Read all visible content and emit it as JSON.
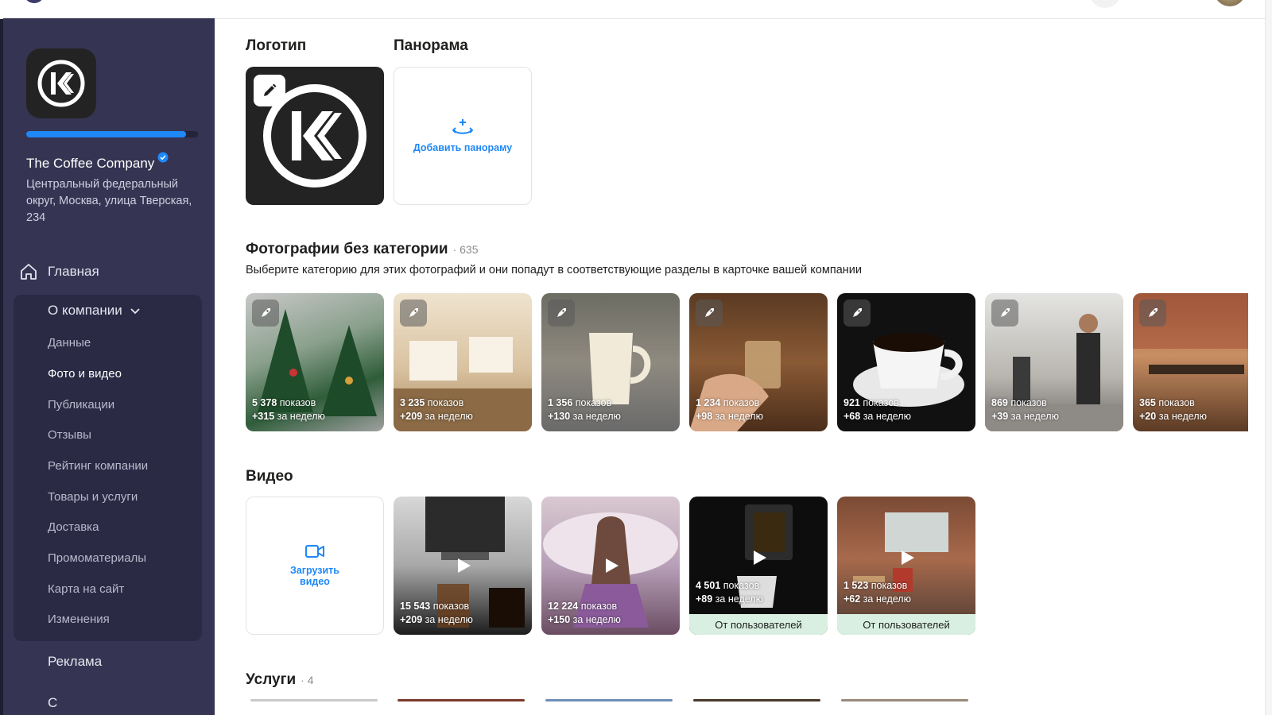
{
  "company": {
    "name": "The Coffee Company",
    "address": "Центральный федеральный округ, Москва, улица Тверская, 234",
    "profile_progress": 0.93,
    "accent": "#1e88f7"
  },
  "sidebar": {
    "home": "Главная",
    "group": "О компании",
    "items": [
      {
        "label": "Данные"
      },
      {
        "label": "Фото и видео"
      },
      {
        "label": "Публикации"
      },
      {
        "label": "Отзывы"
      },
      {
        "label": "Рейтинг компании"
      },
      {
        "label": "Товары и услуги"
      },
      {
        "label": "Доставка"
      },
      {
        "label": "Промоматериалы"
      },
      {
        "label": "Карта на сайт"
      },
      {
        "label": "Изменения"
      }
    ],
    "ads": "Реклама",
    "cut_item": "С"
  },
  "sections": {
    "logo_title": "Логотип",
    "panorama_title": "Панорама",
    "panorama_add": "Добавить панораму",
    "photos_title": "Фотографии без категории",
    "photos_count": "635",
    "photos_desc": "Выберите категорию для этих фотографий и они попадут в соответствующие разделы в карточке вашей компании",
    "video_title": "Видео",
    "video_upload": "Загрузить видео",
    "services_title": "Услуги",
    "services_count": "4"
  },
  "photos": [
    {
      "views": "5 378",
      "views_suffix": "показов",
      "weekly": "+315",
      "weekly_suffix": "за неделю"
    },
    {
      "views": "3 235",
      "views_suffix": "показов",
      "weekly": "+209",
      "weekly_suffix": "за неделю"
    },
    {
      "views": "1 356",
      "views_suffix": "показов",
      "weekly": "+130",
      "weekly_suffix": "за неделю"
    },
    {
      "views": "1 234",
      "views_suffix": "показов",
      "weekly": "+98",
      "weekly_suffix": "за неделю"
    },
    {
      "views": "921",
      "views_suffix": "показов",
      "weekly": "+68",
      "weekly_suffix": "за неделю"
    },
    {
      "views": "869",
      "views_suffix": "показов",
      "weekly": "+39",
      "weekly_suffix": "за неделю"
    },
    {
      "views": "365",
      "views_suffix": "показов",
      "weekly": "+20",
      "weekly_suffix": "за неделю"
    }
  ],
  "videos": [
    {
      "views": "15 543",
      "views_suffix": "показов",
      "weekly": "+209",
      "weekly_suffix": "за неделю"
    },
    {
      "views": "12 224",
      "views_suffix": "показов",
      "weekly": "+150",
      "weekly_suffix": "за неделю"
    },
    {
      "views": "4 501",
      "views_suffix": "показов",
      "weekly": "+89",
      "weekly_suffix": "за неделю",
      "badge": "От пользователей"
    },
    {
      "views": "1 523",
      "views_suffix": "показов",
      "weekly": "+62",
      "weekly_suffix": "за неделю",
      "badge": "От пользователей"
    }
  ],
  "icons": {
    "home": "home-icon",
    "chevron": "chevron-down-icon",
    "edit": "pencil-icon",
    "panorama": "panorama-icon",
    "promo": "rocket-icon",
    "play": "play-icon",
    "video": "video-camera-icon",
    "verified": "verified-icon"
  }
}
